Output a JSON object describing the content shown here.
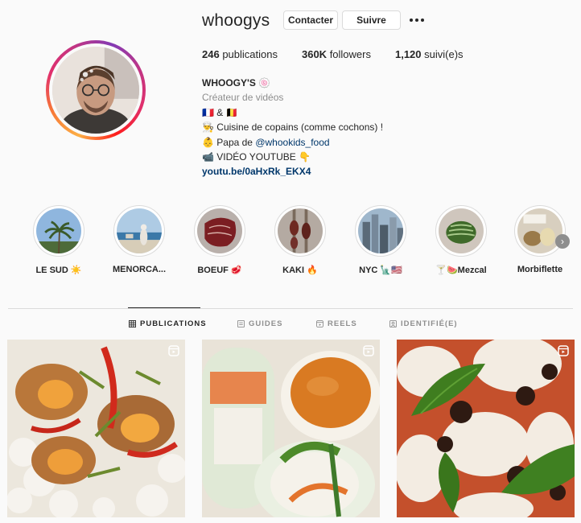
{
  "profile": {
    "username": "whoogys",
    "contact_label": "Contacter",
    "follow_label": "Suivre",
    "more_icon": "more-horizontal-icon"
  },
  "stats": {
    "posts_count": "246",
    "posts_label": "publications",
    "followers_count": "360K",
    "followers_label": "followers",
    "following_count": "1,120",
    "following_label": "suivi(e)s"
  },
  "bio": {
    "name": "WHOOGY'S 🍥",
    "category": "Créateur de vidéos",
    "line1": "🇫🇷 & 🇧🇪",
    "line2": "👨‍🍳 Cuisine de copains (comme cochons) !",
    "line3_prefix": "👶 Papa de ",
    "line3_handle": "@whookids_food",
    "line4": "📹 VIDÉO YOUTUBE 👇",
    "link": "youtu.be/0aHxRk_EKX4"
  },
  "highlights": [
    {
      "label": "LE SUD ☀️"
    },
    {
      "label": "MENORCA..."
    },
    {
      "label": "BOEUF 🥩"
    },
    {
      "label": "KAKI 🔥"
    },
    {
      "label": "NYC 🗽🇺🇸"
    },
    {
      "label": "🍸🍉Mezcal"
    },
    {
      "label": "Morbiflette"
    }
  ],
  "tabs": [
    {
      "label": "PUBLICATIONS",
      "icon": "grid-icon",
      "active": true
    },
    {
      "label": "GUIDES",
      "icon": "guides-icon",
      "active": false
    },
    {
      "label": "REELS",
      "icon": "reels-icon",
      "active": false
    },
    {
      "label": "IDENTIFIÉ(E)",
      "icon": "tagged-icon",
      "active": false
    }
  ],
  "posts": [
    {
      "type": "reel",
      "icon": "reel-icon"
    },
    {
      "type": "reel",
      "icon": "reel-icon"
    },
    {
      "type": "reel",
      "icon": "reel-icon"
    }
  ],
  "colors": {
    "link": "#00376b",
    "muted": "#8e8e8e",
    "text": "#262626",
    "border": "#dbdbdb"
  }
}
